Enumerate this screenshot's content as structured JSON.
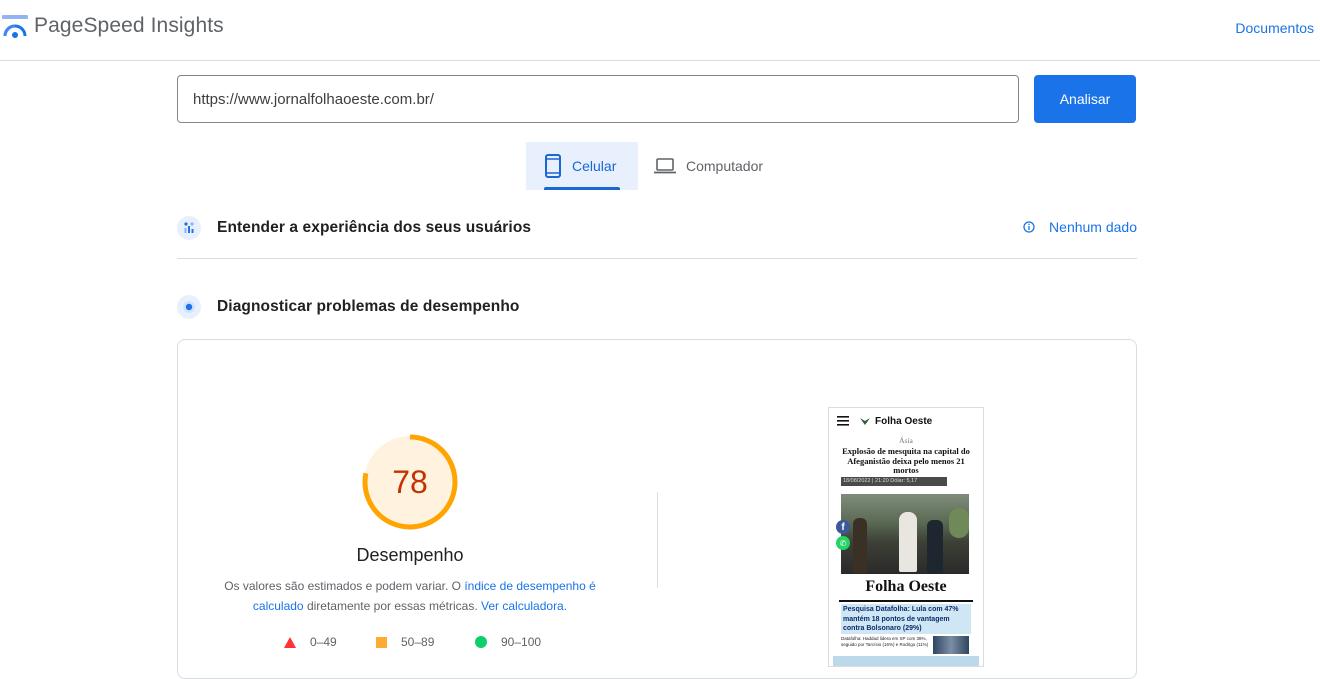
{
  "header": {
    "brand": "PageSpeed Insights",
    "docs_link": "Documentos",
    "logo_icon": "pagespeed-logo-icon"
  },
  "search": {
    "url": "https://www.jornalfolhaoeste.com.br/",
    "analyze_label": "Analisar"
  },
  "tabs": [
    {
      "label": "Celular",
      "icon": "smartphone-icon",
      "active": true
    },
    {
      "label": "Computador",
      "icon": "laptop-icon",
      "active": false
    }
  ],
  "field_data": {
    "title": "Entender a experiência dos seus usuários",
    "status": "Nenhum dado"
  },
  "lab_data": {
    "title": "Diagnosticar problemas de desempenho"
  },
  "performance": {
    "score": "78",
    "score_value": 78,
    "label": "Desempenho",
    "note_part1": "Os valores são estimados e podem variar. O ",
    "note_link1": "índice de desempenho é calculado",
    "note_part2": " diretamente por essas métricas. ",
    "note_link2": "Ver calculadora."
  },
  "legend": [
    {
      "range": "0–49",
      "color": "#ff3333",
      "shape": "triangle"
    },
    {
      "range": "50–89",
      "color": "#ffaa33",
      "shape": "square"
    },
    {
      "range": "90–100",
      "color": "#0cce6b",
      "shape": "circle"
    }
  ],
  "colors": {
    "accent": "#1a73e8",
    "score_average": "#ffa400",
    "score_text": "#c33300",
    "gauge_bg": "#fff3e0"
  },
  "preview": {
    "site_name": "Folha Oeste",
    "category": "Ásia",
    "headline": "Explosão de mesquita na capital do Afeganistão deixa pelo menos 21 mortos",
    "meta": "18/08/2022 | 21:20    Dólar: 5,17",
    "masthead": "Folha Oeste",
    "story": "Pesquisa Datafolha: Lula com 47% mantém 18 pontos de vantagem contra Bolsonaro (29%)",
    "sub": "Datafolha: Haddad lidera em SP com 38%, seguido por Tarcísio (16%) e Rodrigo (11%)"
  }
}
